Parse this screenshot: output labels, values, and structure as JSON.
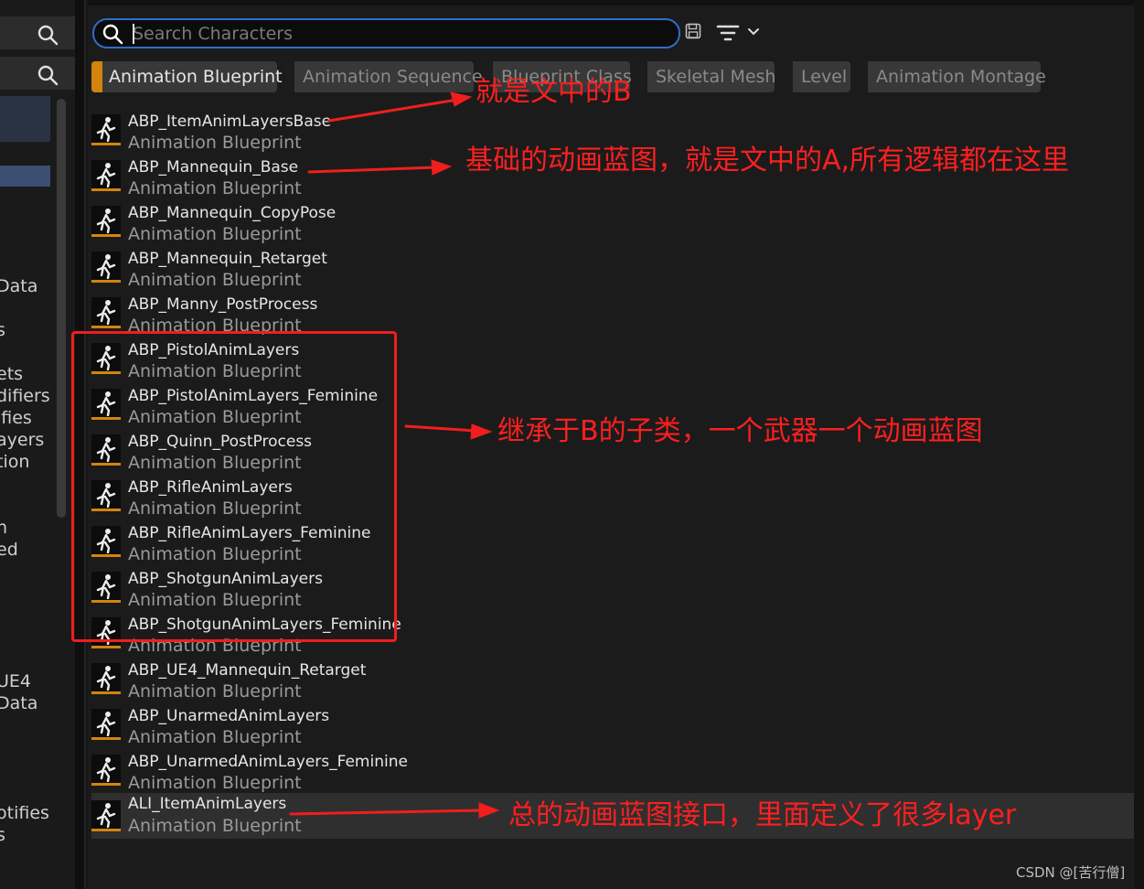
{
  "left_panel": {
    "items": [
      "Data",
      "s",
      "ets",
      "difiers",
      "ifies",
      "ayers",
      "tion",
      "n",
      "ed",
      "UE4",
      "Data",
      "otifies",
      "s"
    ]
  },
  "search": {
    "placeholder": "Search Characters",
    "value": ""
  },
  "filter_chips": [
    {
      "label": "Animation Blueprint",
      "active": true
    },
    {
      "label": "Animation Sequence",
      "active": false
    },
    {
      "label": "Blueprint Class",
      "active": false
    },
    {
      "label": "Skeletal Mesh",
      "active": false
    },
    {
      "label": "Level",
      "active": false
    },
    {
      "label": "Animation Montage",
      "active": false
    }
  ],
  "assets": [
    {
      "name": "ABP_ItemAnimLayersBase",
      "type": "Animation Blueprint"
    },
    {
      "name": "ABP_Mannequin_Base",
      "type": "Animation Blueprint"
    },
    {
      "name": "ABP_Mannequin_CopyPose",
      "type": "Animation Blueprint"
    },
    {
      "name": "ABP_Mannequin_Retarget",
      "type": "Animation Blueprint"
    },
    {
      "name": "ABP_Manny_PostProcess",
      "type": "Animation Blueprint"
    },
    {
      "name": "ABP_PistolAnimLayers",
      "type": "Animation Blueprint"
    },
    {
      "name": "ABP_PistolAnimLayers_Feminine",
      "type": "Animation Blueprint"
    },
    {
      "name": "ABP_Quinn_PostProcess",
      "type": "Animation Blueprint"
    },
    {
      "name": "ABP_RifleAnimLayers",
      "type": "Animation Blueprint"
    },
    {
      "name": "ABP_RifleAnimLayers_Feminine",
      "type": "Animation Blueprint"
    },
    {
      "name": "ABP_ShotgunAnimLayers",
      "type": "Animation Blueprint"
    },
    {
      "name": "ABP_ShotgunAnimLayers_Feminine",
      "type": "Animation Blueprint"
    },
    {
      "name": "ABP_UE4_Mannequin_Retarget",
      "type": "Animation Blueprint"
    },
    {
      "name": "ABP_UnarmedAnimLayers",
      "type": "Animation Blueprint"
    },
    {
      "name": "ABP_UnarmedAnimLayers_Feminine",
      "type": "Animation Blueprint"
    },
    {
      "name": "ALI_ItemAnimLayers",
      "type": "Animation Blueprint",
      "selected": true
    }
  ],
  "annotations": {
    "note_b": "就是文中的B",
    "note_a": "基础的动画蓝图，就是文中的A,所有逻辑都在这里",
    "note_children": "继承于B的子类，一个武器一个动画蓝图",
    "note_interface": "总的动画蓝图接口，里面定义了很多layer"
  },
  "watermark": "CSDN @[苦行僧]",
  "colors": {
    "accent": "#d2840e",
    "search_border": "#2e6ec9",
    "annotation": "#f01e1e"
  }
}
